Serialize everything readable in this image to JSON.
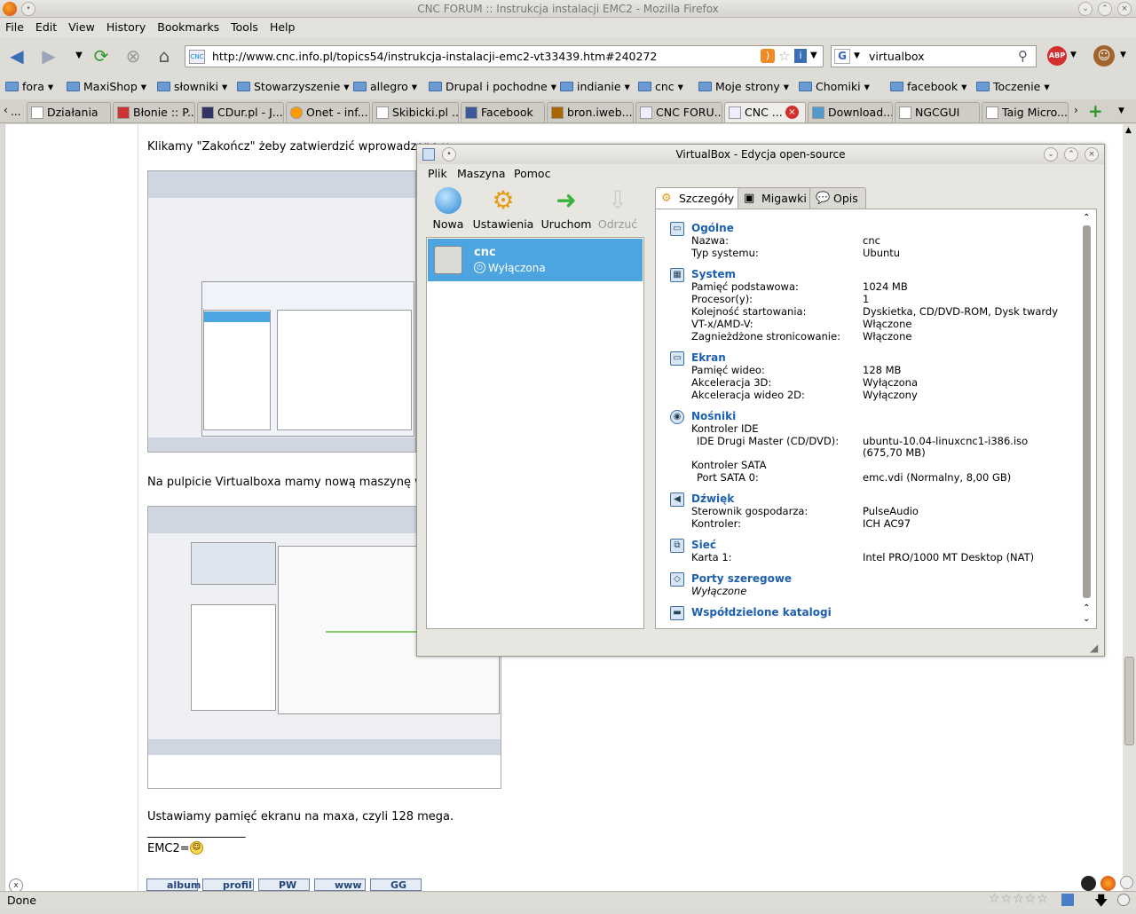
{
  "browser": {
    "title": "CNC FORUM :: Instrukcja instalacji EMC2 - Mozilla Firefox",
    "menu": [
      "File",
      "Edit",
      "View",
      "History",
      "Bookmarks",
      "Tools",
      "Help"
    ],
    "url": "http://www.cnc.info.pl/topics54/instrukcja-instalacji-emc2-vt33439.htm#240272",
    "search_value": "virtualbox",
    "bookmarks": [
      "fora",
      "MaxiShop",
      "słowniki",
      "Stowarzyszenie",
      "allegro",
      "Drupal i pochodne",
      "indianie",
      "cnc",
      "Moje strony",
      "Chomiki",
      "facebook",
      "Toczenie"
    ],
    "tabs": [
      "Działania",
      "Błonie :: P...",
      "CDur.pl - J...",
      "Onet - inf...",
      "Skibicki.pl ...",
      "Facebook",
      "bron.iweb....",
      "CNC FORU...",
      "CNC ...",
      "Download...",
      "NGCGUI",
      "Taig Micro..."
    ],
    "status": "Done"
  },
  "page": {
    "text1": "Klikamy \"Zakończ\" żeby zatwierdzić wprowadzone u",
    "text2": "Na pulpicie Virtualboxa mamy nową maszynę wirtu",
    "text3": "Ustawiamy pamięć ekranu na maxa, czyli 128 mega.",
    "sig_line": "_________________",
    "sig": "EMC2=",
    "footer_buttons": [
      "album",
      "profil",
      "PW",
      "www",
      "GG"
    ]
  },
  "vbox": {
    "title": "VirtualBox - Edycja open-source",
    "menu": [
      "Plik",
      "Maszyna",
      "Pomoc"
    ],
    "tools": [
      "Nowa",
      "Ustawienia",
      "Uruchom",
      "Odrzuć"
    ],
    "vm_name": "cnc",
    "vm_state": "Wyłączona",
    "tabs": [
      "Szczegóły",
      "Migawki",
      "Opis"
    ],
    "sections": {
      "general": {
        "title": "Ogólne",
        "rows": [
          [
            "Nazwa:",
            "cnc"
          ],
          [
            "Typ systemu:",
            "Ubuntu"
          ]
        ]
      },
      "system": {
        "title": "System",
        "rows": [
          [
            "Pamięć podstawowa:",
            "1024 MB"
          ],
          [
            "Procesor(y):",
            "1"
          ],
          [
            "Kolejność startowania:",
            "Dyskietka, CD/DVD-ROM, Dysk twardy"
          ],
          [
            "VT-x/AMD-V:",
            "Włączone"
          ],
          [
            "Zagnieżdżone stronicowanie:",
            "Włączone"
          ]
        ]
      },
      "display": {
        "title": "Ekran",
        "rows": [
          [
            "Pamięć wideo:",
            "128 MB"
          ],
          [
            "Akceleracja 3D:",
            "Wyłączona"
          ],
          [
            "Akceleracja wideo 2D:",
            "Wyłączony"
          ]
        ]
      },
      "storage": {
        "title": "Nośniki",
        "ctrl_ide": "Kontroler IDE",
        "ide_label": "IDE Drugi Master (CD/DVD):",
        "ide_value": "ubuntu-10.04-linuxcnc1-i386.iso",
        "ide_size": "(675,70 MB)",
        "ctrl_sata": "Kontroler SATA",
        "sata_label": "Port SATA 0:",
        "sata_value": "emc.vdi (Normalny, 8,00 GB)"
      },
      "audio": {
        "title": "Dźwięk",
        "rows": [
          [
            "Sterownik gospodarza:",
            "PulseAudio"
          ],
          [
            "Kontroler:",
            "ICH AC97"
          ]
        ]
      },
      "network": {
        "title": "Sieć",
        "rows": [
          [
            "Karta 1:",
            "Intel PRO/1000 MT Desktop (NAT)"
          ]
        ]
      },
      "serial": {
        "title": "Porty szeregowe",
        "value": "Wyłączone"
      },
      "shared": {
        "title": "Współdzielone katalogi"
      }
    }
  }
}
